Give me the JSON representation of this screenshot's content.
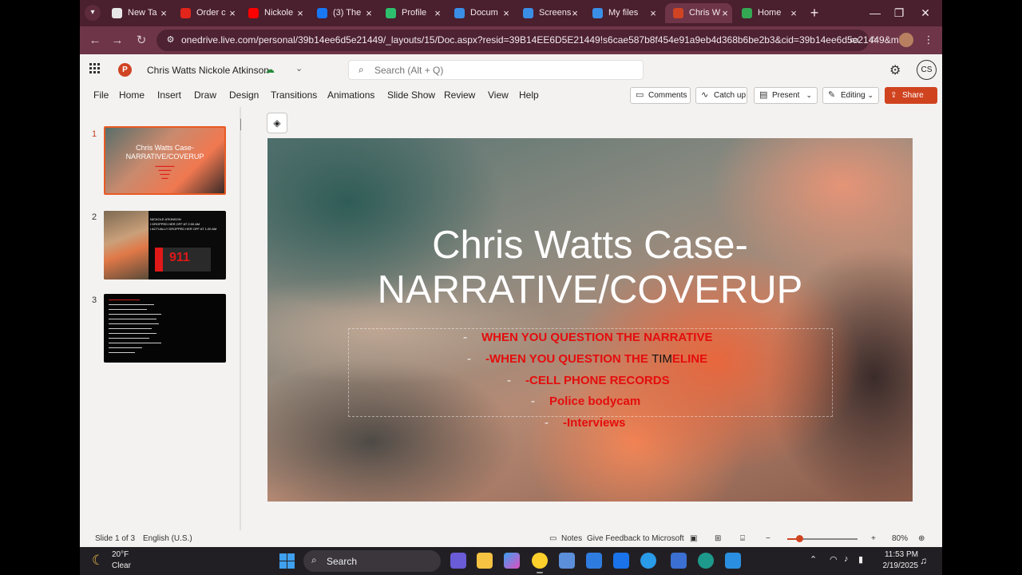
{
  "browser": {
    "tabs": [
      {
        "label": "New Ta",
        "favicon": "chrome-icon",
        "color": "#e8e8e8"
      },
      {
        "label": "Order c",
        "favicon": "adobe-icon",
        "color": "#e1251b"
      },
      {
        "label": "Nickole",
        "favicon": "youtube-icon",
        "color": "#ff0000"
      },
      {
        "label": "(3) The",
        "favicon": "facebook-icon",
        "color": "#1877f2"
      },
      {
        "label": "Profile",
        "favicon": "play-icon",
        "color": "#2ebf6e"
      },
      {
        "label": "Docum",
        "favicon": "onedrive-icon",
        "color": "#3a8ee6"
      },
      {
        "label": "Screens",
        "favicon": "onedrive-icon",
        "color": "#3a8ee6"
      },
      {
        "label": "My files",
        "favicon": "onedrive-icon",
        "color": "#3a8ee6"
      },
      {
        "label": "Chris W",
        "favicon": "powerpoint-icon",
        "color": "#d04423",
        "active": true
      },
      {
        "label": "Home",
        "favicon": "google-drive-icon",
        "color": "#34a853"
      }
    ],
    "url": "onedrive.live.com/personal/39b14ee6d5e21449/_layouts/15/Doc.aspx?resid=39B14EE6D5E21449!s6cae587b8f454e91a9eb4d368b6be2b3&cid=39b14ee6d5e21449&mi..."
  },
  "office": {
    "doc_title": "Chris Watts Nickole Atkinson",
    "search_placeholder": "Search (Alt + Q)",
    "user_initials": "CS"
  },
  "ribbon": {
    "menus": [
      "File",
      "Home",
      "Insert",
      "Draw",
      "Design",
      "Transitions",
      "Animations",
      "Slide Show",
      "Review",
      "View",
      "Help"
    ],
    "comments_label": "Comments",
    "catchup_label": "Catch up",
    "present_label": "Present",
    "editing_label": "Editing",
    "share_label": "Share"
  },
  "thumbnails": [
    {
      "num": "1",
      "title_l1": "Chris Watts Case-",
      "title_l2": "NARRATIVE/COVERUP"
    },
    {
      "num": "2",
      "lines": [
        "NICKOLE ATKINSON",
        "I DROPPED HER OFF AT 2:00 AM",
        "I ACTUALLY DROPPED HER OFF AT 1:20 AM"
      ],
      "big": "911"
    },
    {
      "num": "3"
    }
  ],
  "slide": {
    "title_l1": "Chris Watts Case-",
    "title_l2": "NARRATIVE/COVERUP",
    "bullets": [
      {
        "dash": "-",
        "text": "WHEN YOU QUESTION THE NARRATIVE"
      },
      {
        "dash": "-",
        "text": "-WHEN YOU QUESTION THE ",
        "black": "TIM",
        "tail": "ELINE"
      },
      {
        "dash": "-",
        "text": "-CELL PHONE RECORDS"
      },
      {
        "dash": "-",
        "text": "Police bodycam"
      },
      {
        "dash": "-",
        "text": "-Interviews"
      }
    ]
  },
  "status": {
    "slide_info": "Slide 1 of 3",
    "language": "English (U.S.)",
    "notes": "Notes",
    "feedback": "Give Feedback to Microsoft",
    "zoom": "80%",
    "zoom_fraction": 0.12
  },
  "taskbar": {
    "temp": "20°F",
    "condition": "Clear",
    "search_label": "Search",
    "time": "11:53 PM",
    "date": "2/19/2025"
  }
}
